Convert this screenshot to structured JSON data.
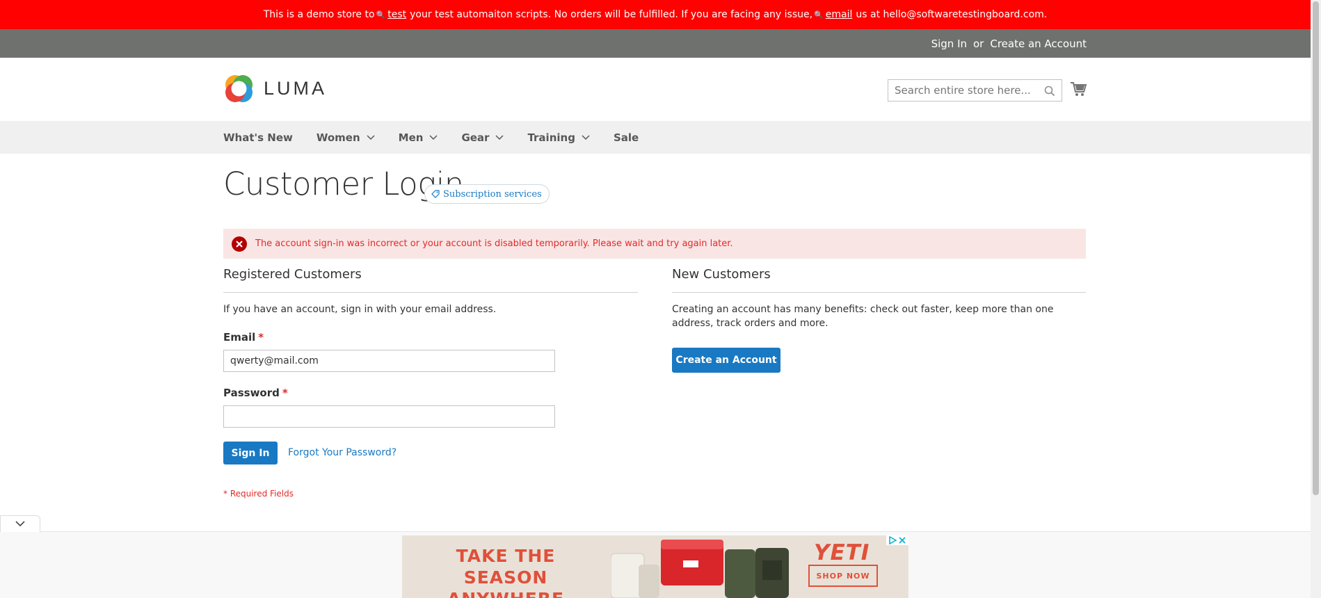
{
  "demo_bar": {
    "part1": "This is a demo store to",
    "link1": "test",
    "part2": "your test automaiton scripts. No orders will be fulfilled. If you are facing any issue,",
    "link2": "email",
    "part3": "us at hello@softwaretestingboard.com."
  },
  "auth": {
    "sign_in": "Sign In",
    "or": "or",
    "create_account": "Create an Account"
  },
  "header": {
    "logo_text": "LUMA",
    "search_placeholder": "Search entire store here...",
    "search_icon": "magnifier-icon",
    "cart_icon": "cart-icon"
  },
  "nav": {
    "items": [
      {
        "label": "What's New",
        "has_submenu": false
      },
      {
        "label": "Women",
        "has_submenu": true
      },
      {
        "label": "Men",
        "has_submenu": true
      },
      {
        "label": "Gear",
        "has_submenu": true
      },
      {
        "label": "Training",
        "has_submenu": true
      },
      {
        "label": "Sale",
        "has_submenu": false
      }
    ]
  },
  "page": {
    "title": "Customer Login",
    "badge": "Subscription services",
    "error": "The account sign-in was incorrect or your account is disabled temporarily. Please wait and try again later."
  },
  "registered": {
    "title": "Registered Customers",
    "intro": "If you have an account, sign in with your email address.",
    "email_label": "Email",
    "email_value": "qwerty@mail.com",
    "password_label": "Password",
    "password_value": "",
    "required_mark": "*",
    "sign_in_button": "Sign In",
    "forgot_link": "Forgot Your Password?",
    "required_note": "* Required Fields"
  },
  "new_customers": {
    "title": "New Customers",
    "text": "Creating an account has many benefits: check out faster, keep more than one address, track orders and more.",
    "create_button": "Create an Account"
  },
  "ad": {
    "headline": "TAKE THE SEASON ANYWHERE",
    "brand": "YETI",
    "cta": "SHOP NOW"
  },
  "colors": {
    "demo_bar": "#ff0101",
    "auth_bar": "#6e716e",
    "primary": "#1979c3",
    "error": "#e02b27",
    "error_bg": "#fae5e5"
  }
}
